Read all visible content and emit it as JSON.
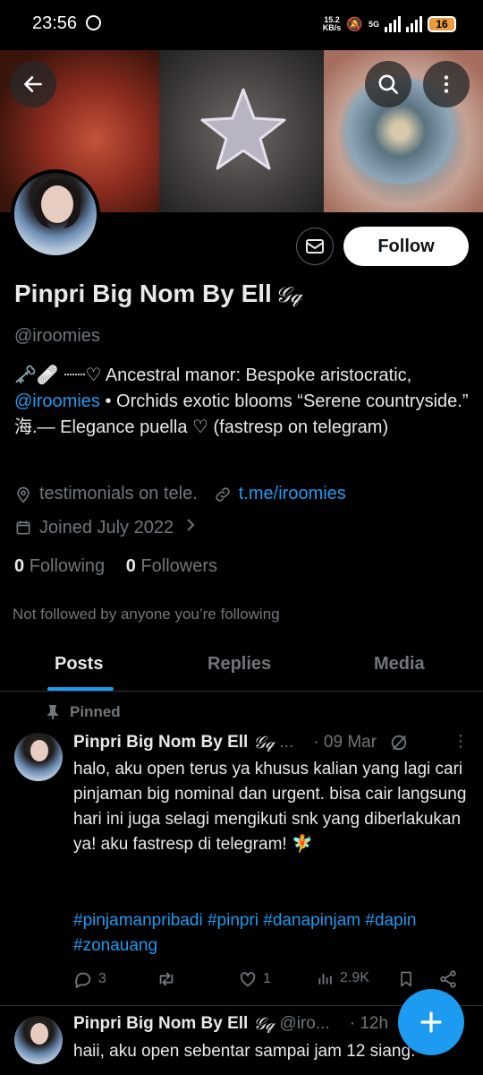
{
  "status_bar": {
    "time": "23:56",
    "net_speed_top": "15.2",
    "net_speed_bottom": "KB/s",
    "network": "5G",
    "battery": "16"
  },
  "profile": {
    "name": "Pinpri Big Nom By Ell",
    "name_glyph": "𝒢𝓆",
    "handle": "@iroomies",
    "follow_label": "Follow",
    "bio_part1": "🗝️🩹 ┈┈♡ Ancestral manor: Bespoke aristocratic, ",
    "bio_mention": "@iroomies",
    "bio_part2": " • Orchids exotic blooms “Serene countryside.” 海.— Elegance puella ♡ (fastresp on telegram)",
    "location": "testimonials on tele.",
    "website": "t.me/iroomies",
    "joined": "Joined July 2022",
    "following_count": "0",
    "following_label": "Following",
    "followers_count": "0",
    "followers_label": "Followers",
    "not_followed": "Not followed by anyone you’re following"
  },
  "tabs": [
    {
      "label": "Posts",
      "active": true
    },
    {
      "label": "Replies",
      "active": false
    },
    {
      "label": "Media",
      "active": false
    }
  ],
  "posts": [
    {
      "pinned_label": "Pinned",
      "author": "Pinpri Big Nom By Ell",
      "glyph": "𝒢𝓆",
      "handle_trunc": "...",
      "date": "· 09 Mar",
      "text": "halo, aku open terus ya khusus kalian yang lagi cari pinjaman big nominal dan urgent. bisa cair langsung hari ini juga selagi mengikuti snk yang diberlakukan ya! aku fastresp di telegram! 🧚",
      "hashtags": "#pinjamanpribadi #pinpri #danapinjam #dapin #zonauang",
      "replies": "3",
      "likes": "1",
      "views": "2.9K"
    },
    {
      "author": "Pinpri Big Nom By Ell",
      "glyph": "𝒢𝓆",
      "handle_trunc": "@iro...",
      "date": "· 12h",
      "text": "haii, aku open sebentar sampai jam 12 siang."
    }
  ],
  "colors": {
    "accent": "#1d9bf0",
    "muted": "#71767b",
    "text": "#e7e9ea",
    "background": "#000000"
  }
}
